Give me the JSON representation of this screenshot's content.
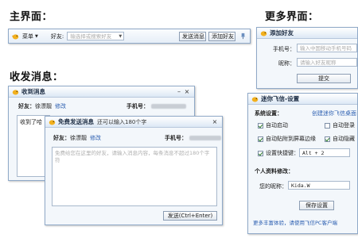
{
  "headings": {
    "main": "主界面：",
    "more": "更多界面：",
    "send_recv": "收发消息："
  },
  "main_bar": {
    "menu_label": "菜单",
    "friend_label": "好友:",
    "search_placeholder": "输选择或搜索好友",
    "send_button": "发送消息",
    "add_friend_button": "添加好友"
  },
  "add_friend_window": {
    "title": "添加好友",
    "phone_label": "手机号：",
    "phone_placeholder": "输入中国移动手机号码",
    "nickname_label": "昵称：",
    "nickname_placeholder": "请输入好友昵称",
    "submit_button": "提交"
  },
  "settings_window": {
    "title": "迷你飞信-设置",
    "system_label": "系统设置：",
    "create_shortcut_link": "创建迷你飞信桌面",
    "options": [
      {
        "label": "自动启动",
        "checked": true
      },
      {
        "label": "自动登录",
        "checked": false
      },
      {
        "label": "自动贴附到屏幕边缘",
        "checked": true
      },
      {
        "label": "自动隐藏",
        "checked": true
      },
      {
        "label": "设置快捷键：",
        "checked": true
      }
    ],
    "hotkey_value": "Alt + 2",
    "profile_label": "个人资料修改：",
    "nickname_label": "您的昵称：",
    "nickname_value": "Kida.W",
    "save_button": "保存设置",
    "footer_link": "更多丰富体验，请使用飞信PC客户端"
  },
  "recv_window": {
    "title": "收到消息",
    "friend_label": "好友：",
    "friend_name": "徐漂靓",
    "edit_link": "修改",
    "phone_label": "手机号：",
    "message_preview": "收到了哈"
  },
  "send_window": {
    "title": "免费发送消息",
    "subtitle": "还可以输入180个字",
    "friend_label": "好友：",
    "friend_name": "徐漂靓",
    "edit_link": "修改",
    "phone_label": "手机号：",
    "textarea_placeholder": "免费给您在这里的好友，请输入消息内容，每条消息不超过180个字符",
    "send_button": "发送(Ctrl+Enter)"
  },
  "icons": {
    "app": "bird-icon",
    "menu": "chevron-down-icon",
    "pin": "pin-icon",
    "close": "close-icon",
    "minimize": "minimize-icon"
  },
  "colors": {
    "window_border": "#8fa9c8",
    "titlebar_top": "#ffffff",
    "titlebar_bottom": "#dce8f5",
    "link": "#2a5db0",
    "bird": "#f2b01e"
  }
}
